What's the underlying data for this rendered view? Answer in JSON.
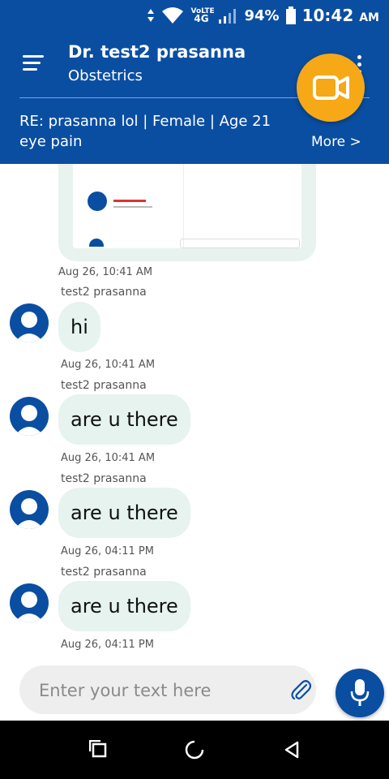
{
  "status_bar": {
    "network_top": "VoLTE",
    "network_bottom": "4G",
    "battery": "94%",
    "time": "10:42",
    "ampm": "AM",
    "icons": [
      "data-arrows-icon",
      "wifi-icon",
      "cellular-signal-icon",
      "battery-icon"
    ]
  },
  "header": {
    "doctor_name": "Dr. test2 prasanna",
    "specialty": "Obstetrics",
    "menu_icon": "hamburger-menu-icon",
    "overflow_icon": "more-vert-icon"
  },
  "video_call": {
    "icon": "video-camera-icon",
    "color": "#f6a817"
  },
  "case": {
    "line1": "RE: prasanna lol | Female | Age 21",
    "line2": "eye pain",
    "more": "More >"
  },
  "chat": {
    "attachment_timestamp": "Aug 26, 10:41 AM",
    "messages": [
      {
        "sender": "test2 prasanna",
        "text": "hi",
        "timestamp": "Aug 26, 10:41 AM"
      },
      {
        "sender": "test2 prasanna",
        "text": "are u there",
        "timestamp": "Aug 26, 10:41 AM"
      },
      {
        "sender": "test2 prasanna",
        "text": "are u there",
        "timestamp": "Aug 26, 04:11 PM"
      },
      {
        "sender": "test2 prasanna",
        "text": "are u there",
        "timestamp": "Aug 26, 04:11 PM"
      }
    ]
  },
  "composer": {
    "placeholder": "Enter your text here",
    "value": "",
    "attach_icon": "paperclip-icon",
    "mic_icon": "microphone-icon"
  },
  "nav": {
    "icons": [
      "recents-square-icon",
      "home-circle-icon",
      "back-triangle-icon"
    ]
  },
  "colors": {
    "primary": "#0a4ea2",
    "accent": "#f6a817",
    "bubble": "#e6f3ee"
  }
}
